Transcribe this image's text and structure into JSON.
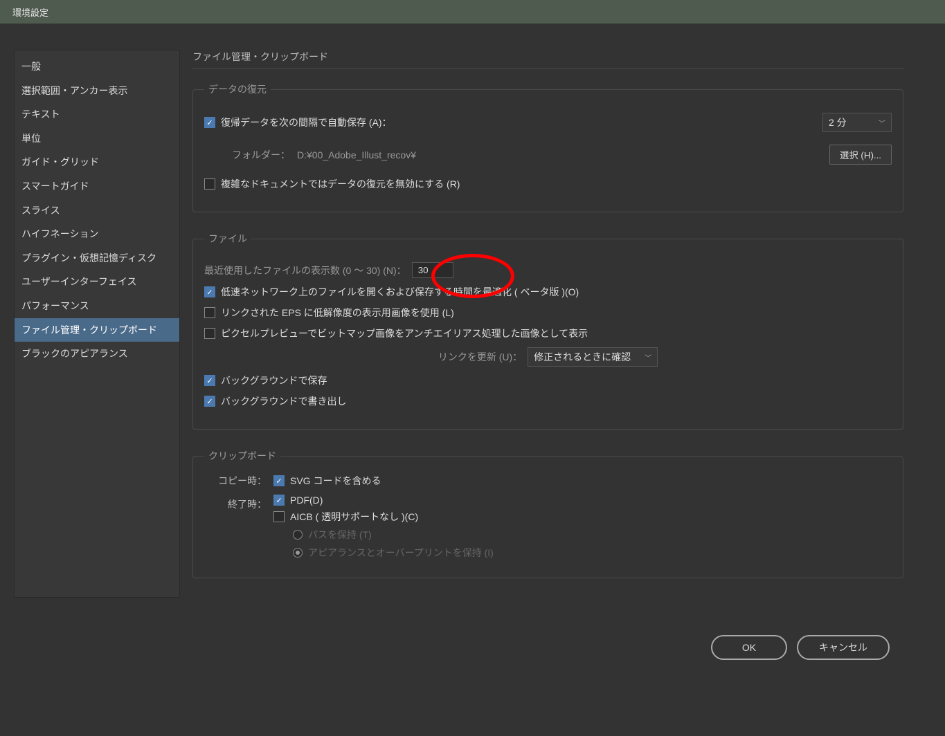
{
  "window": {
    "title": "環境設定"
  },
  "sidebar": {
    "items": [
      "一般",
      "選択範囲・アンカー表示",
      "テキスト",
      "単位",
      "ガイド・グリッド",
      "スマートガイド",
      "スライス",
      "ハイフネーション",
      "プラグイン・仮想記憶ディスク",
      "ユーザーインターフェイス",
      "パフォーマンス",
      "ファイル管理・クリップボード",
      "ブラックのアピアランス"
    ],
    "activeIndex": 11
  },
  "content": {
    "heading": "ファイル管理・クリップボード",
    "dataRecovery": {
      "legend": "データの復元",
      "autosave_label": "復帰データを次の間隔で自動保存 (A)：",
      "autosave_checked": true,
      "interval_value": "2 分",
      "folder_label": "フォルダー：",
      "folder_path": "D:¥00_Adobe_Illust_recov¥",
      "choose_button": "選択 (H)...",
      "disable_complex_label": "複雑なドキュメントではデータの復元を無効にする (R)",
      "disable_complex_checked": false
    },
    "file": {
      "legend": "ファイル",
      "recent_label": "最近使用したファイルの表示数 (0 〜 30) (N)：",
      "recent_value": "30",
      "optimize_label": "低速ネットワーク上のファイルを開くおよび保存する時間を最適化 ( ベータ版 )(O)",
      "optimize_checked": true,
      "eps_label": "リンクされた EPS に低解像度の表示用画像を使用 (L)",
      "eps_checked": false,
      "pixelpreview_label": "ピクセルプレビューでビットマップ画像をアンチエイリアス処理した画像として表示",
      "pixelpreview_checked": false,
      "updatelinks_label": "リンクを更新 (U)：",
      "updatelinks_value": "修正されるときに確認",
      "bg_save_label": "バックグラウンドで保存",
      "bg_save_checked": true,
      "bg_export_label": "バックグラウンドで書き出し",
      "bg_export_checked": true
    },
    "clipboard": {
      "legend": "クリップボード",
      "copy_label": "コピー時：",
      "quit_label": "終了時：",
      "svg_label": "SVG コードを含める",
      "svg_checked": true,
      "pdf_label": "PDF(D)",
      "pdf_checked": true,
      "aicb_label": "AICB ( 透明サポートなし )(C)",
      "aicb_checked": false,
      "preserve_paths_label": "パスを保持 (T)",
      "preserve_appearance_label": "アピアランスとオーバープリントを保持 (I)"
    }
  },
  "footer": {
    "ok": "OK",
    "cancel": "キャンセル"
  }
}
